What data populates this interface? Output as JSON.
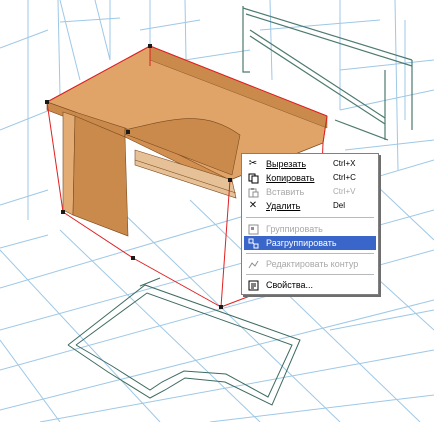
{
  "context_menu": {
    "items": [
      {
        "label": "Вырезать",
        "shortcut": "Ctrl+X",
        "icon": "scissors-icon",
        "enabled": true
      },
      {
        "label": "Копировать",
        "shortcut": "Ctrl+C",
        "icon": "copy-icon",
        "enabled": true
      },
      {
        "label": "Вставить",
        "shortcut": "Ctrl+V",
        "icon": "paste-icon",
        "enabled": false
      },
      {
        "label": "Удалить",
        "shortcut": "Del",
        "icon": "delete-x-icon",
        "enabled": true
      },
      {
        "label": "Группировать",
        "icon": "group-icon",
        "enabled": false
      },
      {
        "label": "Разгруппировать",
        "icon": "ungroup-icon",
        "enabled": true,
        "highlighted": true
      },
      {
        "label": "Редактировать контур",
        "icon": "edit-contour-icon",
        "enabled": false
      },
      {
        "label": "Свойства...",
        "icon": "properties-icon",
        "enabled": true
      }
    ]
  },
  "colors": {
    "grid": "#9ec8e6",
    "desk_top": "#e0a469",
    "desk_side": "#c98a4c",
    "selection": "#e02020",
    "menu_highlight": "#3a66c9",
    "wireframe": "#4d7a6f"
  }
}
